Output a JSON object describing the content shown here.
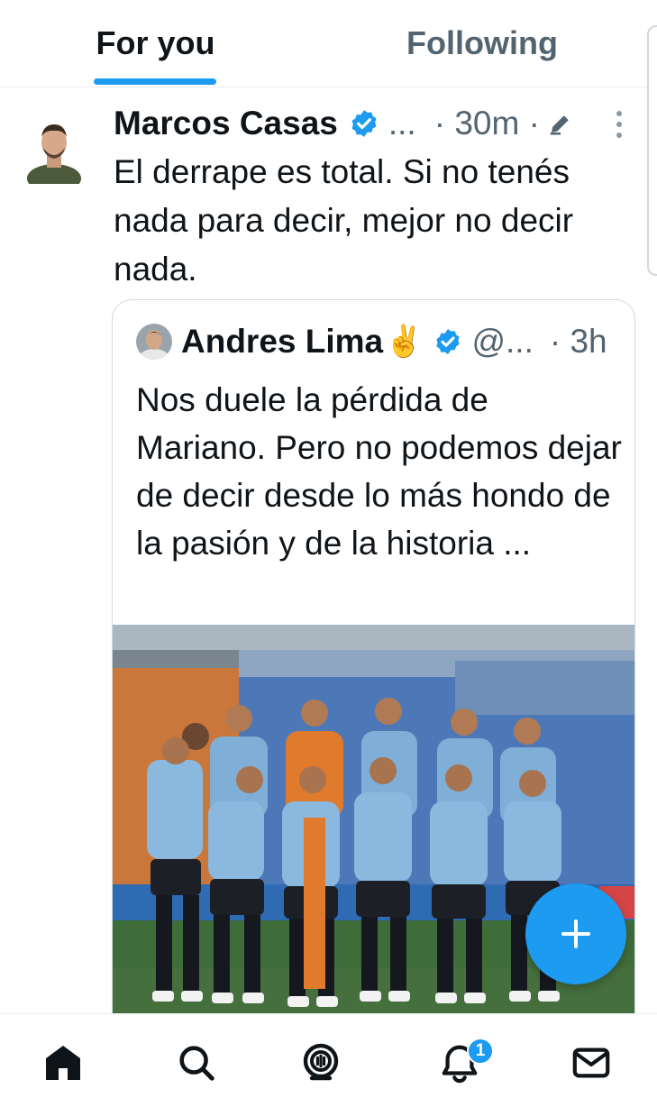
{
  "tabs": [
    {
      "label": "For you",
      "active": true
    },
    {
      "label": "Following",
      "active": false
    }
  ],
  "tweet": {
    "author_name": "Marcos Casas",
    "handle": "...",
    "time": "· 30m ·",
    "text": "El derrape es total. Si no tenés nada para decir, mejor no decir nada.",
    "quoted": {
      "author_name": "Andres Lima",
      "emoji": "✌️",
      "handle": "@...",
      "time": "· 3h",
      "text": "Nos duele la pérdida de Mariano. Pero no podemos dejar de decir desde lo más hondo de la pasión y de la historia ..."
    }
  },
  "nav": {
    "items": [
      "home-icon",
      "search-icon",
      "spaces-icon",
      "notifications-icon",
      "messages-icon"
    ],
    "notifications_badge": "1"
  },
  "colors": {
    "accent": "#1d9bf0",
    "text_primary": "#0f1419",
    "text_secondary": "#536471"
  }
}
